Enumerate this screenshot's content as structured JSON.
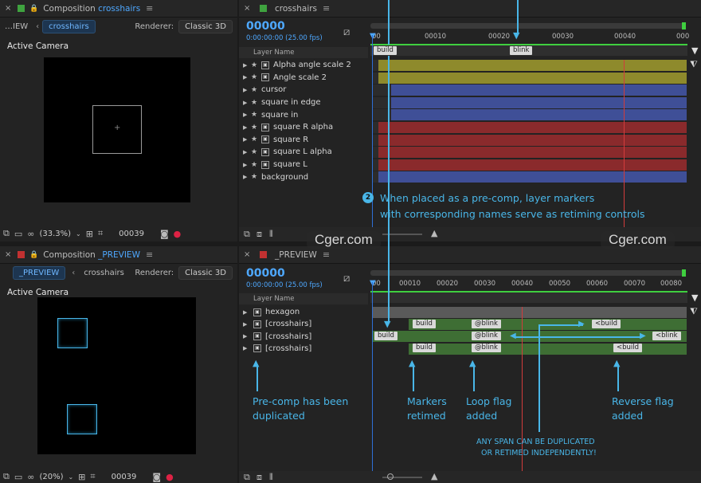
{
  "comp_top": {
    "title_prefix": "Composition",
    "title_name": "crosshairs",
    "view_label": "…IEW",
    "view_chip": "crosshairs",
    "renderer_label": "Renderer:",
    "renderer_value": "Classic 3D",
    "camera_label": "Active Camera",
    "zoom": "(33.3%)",
    "frame": "00039"
  },
  "comp_bottom": {
    "title_prefix": "Composition",
    "title_name": "_PREVIEW",
    "view_chip": "_PREVIEW",
    "view_chip2": "crosshairs",
    "renderer_label": "Renderer:",
    "renderer_value": "Classic 3D",
    "camera_label": "Active Camera",
    "zoom": "(20%)",
    "frame": "00039"
  },
  "tl_top": {
    "tab": "crosshairs",
    "timecode": "00000",
    "fps": "0:00:00:00 (25.00 fps)",
    "col_header": "Layer Name",
    "ruler": [
      "00",
      "00010",
      "00020",
      "00030",
      "00040",
      "000"
    ],
    "layers": [
      {
        "name": "Alpha angle scale 2",
        "icon": "comp"
      },
      {
        "name": "Angle scale 2",
        "icon": "comp"
      },
      {
        "name": "cursor",
        "icon": "none"
      },
      {
        "name": "square in edge",
        "icon": "none"
      },
      {
        "name": "square in",
        "icon": "none"
      },
      {
        "name": "square R alpha",
        "icon": "comp"
      },
      {
        "name": "square R",
        "icon": "comp"
      },
      {
        "name": "square L alpha",
        "icon": "comp"
      },
      {
        "name": "square L",
        "icon": "comp"
      },
      {
        "name": "background",
        "icon": "none"
      }
    ],
    "markers": [
      "build",
      "blink"
    ],
    "note_num": "2",
    "note_line1": "When placed as a pre-comp, layer markers",
    "note_line2": "with corresponding names serve as retiming controls"
  },
  "tl_bottom": {
    "tab": "_PREVIEW",
    "timecode": "00000",
    "fps": "0:00:00:00 (25.00 fps)",
    "col_header": "Layer Name",
    "ruler": [
      "00",
      "00010",
      "00020",
      "00030",
      "00040",
      "00050",
      "00060",
      "00070",
      "00080"
    ],
    "layers": [
      {
        "name": "hexagon"
      },
      {
        "name": "[crosshairs]"
      },
      {
        "name": "[crosshairs]"
      },
      {
        "name": "[crosshairs]"
      }
    ],
    "markers": {
      "row1": [
        "build",
        "@blink",
        "<build"
      ],
      "row2": [
        "build",
        "@blink",
        "<blink"
      ],
      "row3": [
        "build",
        "@blink",
        "<build"
      ]
    },
    "ann_precomp": [
      "Pre-comp has been",
      "duplicated"
    ],
    "ann_markers": [
      "Markers",
      "retimed"
    ],
    "ann_loop": [
      "Loop flag",
      "added"
    ],
    "ann_reverse": [
      "Reverse flag",
      "added"
    ],
    "ann_span": [
      "ANY SPAN CAN BE DUPLICATED",
      "OR RETIMED INDEPENDENTLY!"
    ]
  },
  "watermark": "Cger.com",
  "colors": {
    "accent": "#4ea8ff",
    "annotation": "#49b6e8",
    "bar_yellow": "#8e8a2c",
    "bar_blue": "#3f4f97",
    "bar_red": "#8a2a2c",
    "bar_green": "#3e6e34",
    "bar_grey": "#5a5a5a",
    "cti": "#d23c3c"
  }
}
